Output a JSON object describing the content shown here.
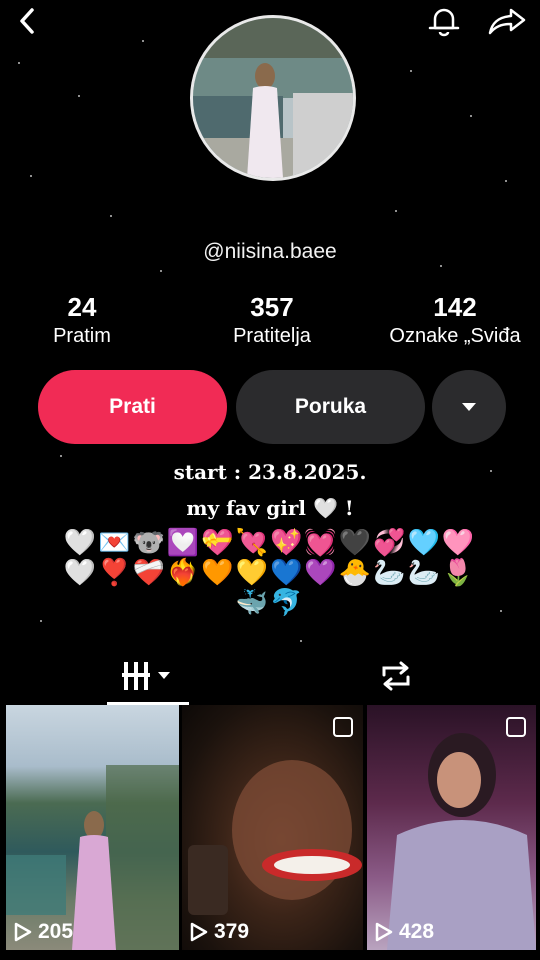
{
  "profile": {
    "username": "@niisina.baee"
  },
  "stats": [
    {
      "value": "24",
      "label": "Pratim"
    },
    {
      "value": "357",
      "label": "Pratitelja"
    },
    {
      "value": "142",
      "label": "Oznake „Sviđa"
    }
  ],
  "actions": {
    "follow_label": "Prati",
    "message_label": "Poruka"
  },
  "bio": {
    "line1": "start : 23.8.2025.",
    "line2": "my fav girl 🤍 !",
    "emoji_row1": "🤍💌🐨💟💝💘💖💓🖤💞🩵🩷",
    "emoji_row2": "🤍❣️❤️‍🩹❤️‍🔥🧡💛💙💜🐣🦢🦢🌷",
    "emoji_row3": "🐳🐬"
  },
  "videos": [
    {
      "views": "205"
    },
    {
      "views": "379"
    },
    {
      "views": "428"
    }
  ],
  "icons": [
    "back-icon",
    "bell-icon",
    "share-icon",
    "dropdown-icon",
    "grid-icon",
    "repost-icon",
    "play-icon"
  ]
}
